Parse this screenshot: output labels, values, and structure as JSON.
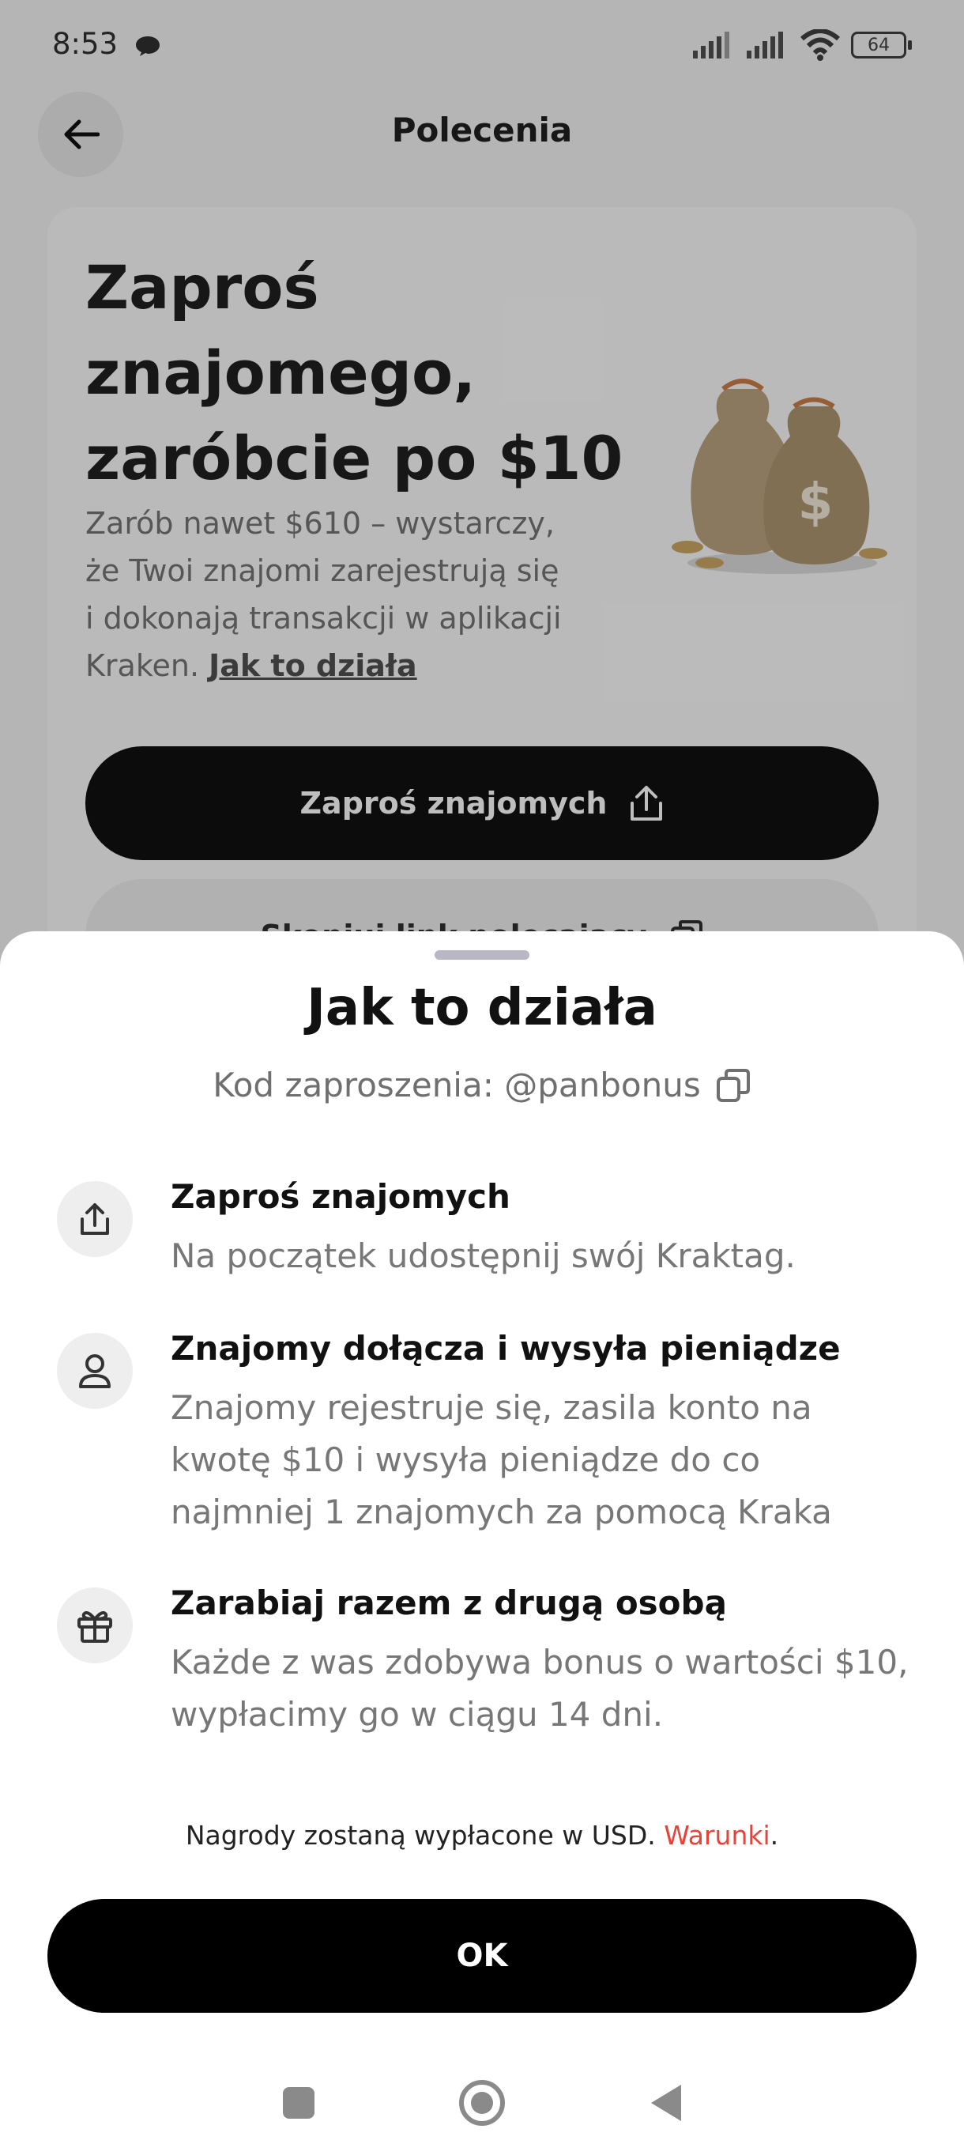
{
  "status_bar": {
    "time": "8:53",
    "battery": "64"
  },
  "header": {
    "title": "Polecenia"
  },
  "promo": {
    "title": "Zaproś znajomego, zaróbcie po $10",
    "description": "Zarób nawet $610 – wystarczy, że Twoi znajomi zarejestrują się i dokonają transakcji w aplikacji Kraken.",
    "link": "Jak to działa",
    "invite_button": "Zaproś znajomych",
    "copy_link_button": "Skopiuj link polecający"
  },
  "sheet": {
    "title": "Jak to działa",
    "invite_code_label": "Kod zaproszenia: @panbonus",
    "steps": [
      {
        "icon": "share-icon",
        "title": "Zaproś znajomych",
        "description": "Na początek udostępnij swój Kraktag."
      },
      {
        "icon": "user-icon",
        "title": "Znajomy dołącza i wysyła pieniądze",
        "description": "Znajomy rejestruje się, zasila konto na kwotę $10 i wysyła pieniądze do co najmniej 1 znajomych za pomocą Kraka"
      },
      {
        "icon": "gift-icon",
        "title": "Zarabiaj razem z drugą osobą",
        "description": "Każde z was zdobywa bonus o wartości $10, wypłacimy go w ciągu 14 dni."
      }
    ],
    "footnote_text": "Nagrody zostaną wypłacone w USD.",
    "footnote_link": "Warunki",
    "footnote_end": ".",
    "ok_button": "OK"
  },
  "colors": {
    "accent": "#000000",
    "link_red": "#e8433a",
    "icon_bg": "#eeeeee"
  }
}
